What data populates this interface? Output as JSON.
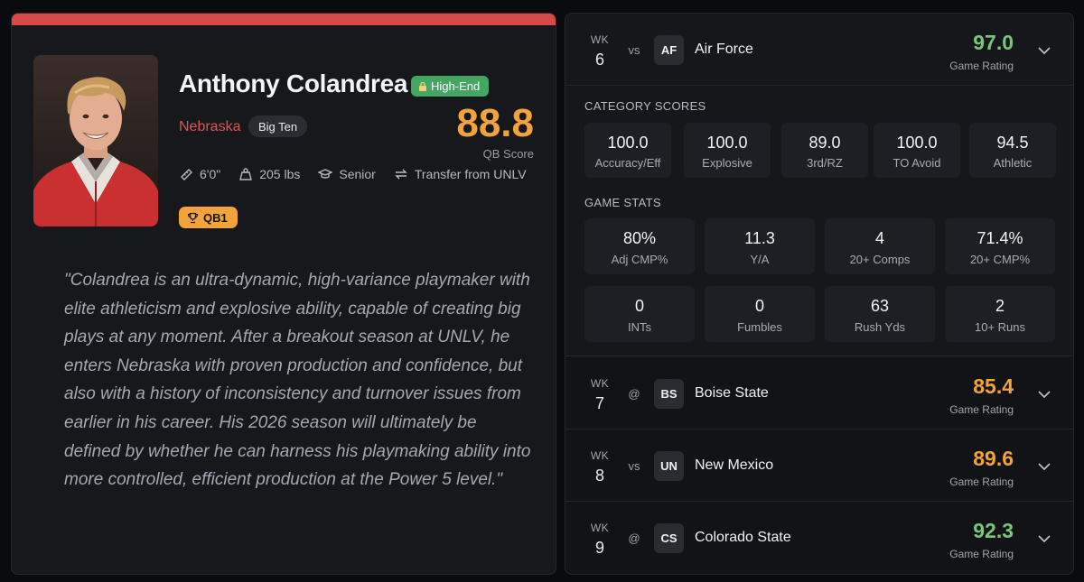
{
  "player": {
    "name": "Anthony Colandrea",
    "tier": "High-End",
    "team": "Nebraska",
    "conference": "Big Ten",
    "qb_score": "88.8",
    "qb_score_label": "QB Score",
    "height": "6'0\"",
    "weight": "205 lbs",
    "class_year": "Senior",
    "transfer": "Transfer from UNLV",
    "depth": "QB1",
    "summary": "\"Colandrea is an ultra-dynamic, high-variance playmaker with elite athleticism and explosive ability, capable of creating big plays at any moment. After a breakout season at UNLV, he enters Nebraska with proven production and confidence, but also with a history of inconsistency and turnover issues from earlier in his career. His 2026 season will ultimately be defined by whether he can harness his playmaking ability into more controlled, efficient production at the Power 5 level.\""
  },
  "colors": {
    "accent": "#d84a48",
    "score_orange": "#f2a33a",
    "rating_green": "#79c77b",
    "tier_green": "#45a663"
  },
  "games": [
    {
      "wk_label": "WK",
      "week": "6",
      "location": "vs",
      "abbr": "AF",
      "opponent": "Air Force",
      "rating": "97.0",
      "rating_color": "#79c77b",
      "rating_label": "Game Rating",
      "expanded": true,
      "category_scores_label": "CATEGORY SCORES",
      "category_scores": [
        {
          "value": "100.0",
          "label": "Accuracy/Eff"
        },
        {
          "value": "100.0",
          "label": "Explosive"
        },
        {
          "value": "89.0",
          "label": "3rd/RZ"
        },
        {
          "value": "100.0",
          "label": "TO Avoid"
        },
        {
          "value": "94.5",
          "label": "Athletic"
        }
      ],
      "game_stats_label": "GAME STATS",
      "game_stats": [
        {
          "value": "80%",
          "label": "Adj CMP%"
        },
        {
          "value": "11.3",
          "label": "Y/A"
        },
        {
          "value": "4",
          "label": "20+ Comps"
        },
        {
          "value": "71.4%",
          "label": "20+ CMP%"
        },
        {
          "value": "0",
          "label": "INTs"
        },
        {
          "value": "0",
          "label": "Fumbles"
        },
        {
          "value": "63",
          "label": "Rush Yds"
        },
        {
          "value": "2",
          "label": "10+ Runs"
        }
      ]
    },
    {
      "wk_label": "WK",
      "week": "7",
      "location": "@",
      "abbr": "BS",
      "opponent": "Boise State",
      "rating": "85.4",
      "rating_color": "#f2a33a",
      "rating_label": "Game Rating",
      "expanded": false
    },
    {
      "wk_label": "WK",
      "week": "8",
      "location": "vs",
      "abbr": "UN",
      "opponent": "New Mexico",
      "rating": "89.6",
      "rating_color": "#f2a33a",
      "rating_label": "Game Rating",
      "expanded": false
    },
    {
      "wk_label": "WK",
      "week": "9",
      "location": "@",
      "abbr": "CS",
      "opponent": "Colorado State",
      "rating": "92.3",
      "rating_color": "#79c77b",
      "rating_label": "Game Rating",
      "expanded": false
    }
  ],
  "icons": {
    "height": "ruler-icon",
    "weight": "weight-icon",
    "class_year": "graduation-cap-icon",
    "transfer": "transfer-arrows-icon",
    "depth": "trophy-icon",
    "tier": "lock-icon",
    "expand": "chevron-down-icon"
  }
}
